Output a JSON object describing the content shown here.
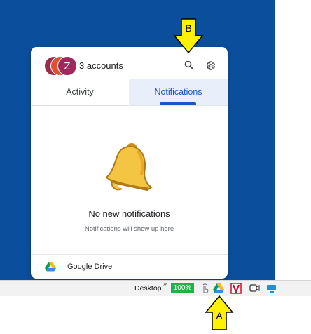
{
  "popup": {
    "accounts_label": "3 accounts",
    "avatar_initial": "Z",
    "tabs": [
      {
        "label": "Activity",
        "selected": false
      },
      {
        "label": "Notifications",
        "selected": true
      }
    ],
    "empty_title": "No new notifications",
    "empty_subtitle": "Notifications will show up here",
    "footer_label": "Google Drive"
  },
  "taskbar": {
    "desktop_label": "Desktop",
    "chevron": "»",
    "battery_label": "100%"
  },
  "callouts": {
    "b_label": "B",
    "a_label": "A"
  },
  "icons": {
    "search": "search-icon",
    "settings": "gear-icon",
    "bell": "bell-icon",
    "drive": "google-drive-icon"
  },
  "colors": {
    "desktop_bg": "#0b4f9c",
    "accent": "#1a57c5",
    "bell": "#f4c542",
    "battery": "#20b24a",
    "callout": "#fff200"
  }
}
